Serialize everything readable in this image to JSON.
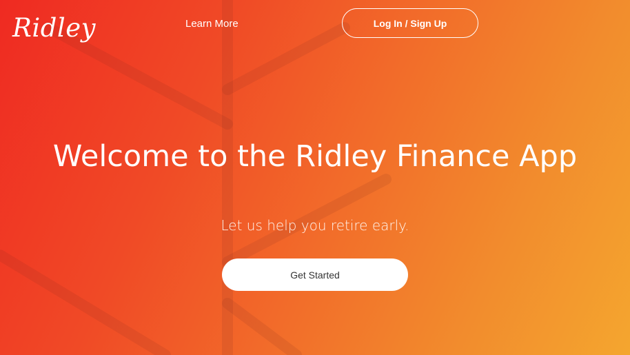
{
  "header": {
    "logo_text": "Ridley",
    "nav_learn_more": "Learn More",
    "login_label": "Log In / Sign Up"
  },
  "hero": {
    "headline": "Welcome to the Ridley Finance App",
    "subtitle": "Let us help you retire early.",
    "cta_label": "Get Started"
  },
  "theme": {
    "gradient_start": "#ef2a22",
    "gradient_end": "#f4a62f",
    "text_color": "#ffffff",
    "cta_background": "#ffffff",
    "cta_text_color": "#333333"
  }
}
